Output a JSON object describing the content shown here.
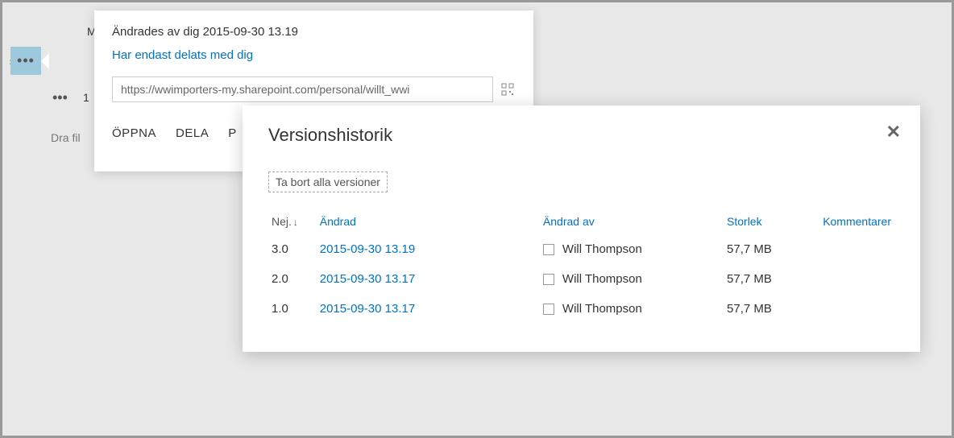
{
  "background": {
    "row1_letter": "M",
    "row3_num": "1",
    "drag_hint": "Dra fil"
  },
  "callout": {
    "title": "Ändrades av dig 2015-09-30 13.19",
    "shared_with": "Har endast delats med dig",
    "url": "https://wwimporters-my.sharepoint.com/personal/willt_wwi",
    "actions": {
      "open": "ÖPPNA",
      "share": "DELA",
      "more_prefix": "P"
    }
  },
  "dialog": {
    "title": "Versionshistorik",
    "delete_all": "Ta bort alla versioner",
    "columns": {
      "no": "Nej.",
      "modified": "Ändrad",
      "modified_by": "Ändrad av",
      "size": "Storlek",
      "comments": "Kommentarer"
    },
    "rows": [
      {
        "no": "3.0",
        "date": "2015-09-30 13.19",
        "author": "Will Thompson",
        "size": "57,7 MB"
      },
      {
        "no": "2.0",
        "date": "2015-09-30 13.17",
        "author": "Will Thompson",
        "size": "57,7 MB"
      },
      {
        "no": "1.0",
        "date": "2015-09-30 13.17",
        "author": "Will Thompson",
        "size": "57,7 MB"
      }
    ]
  }
}
